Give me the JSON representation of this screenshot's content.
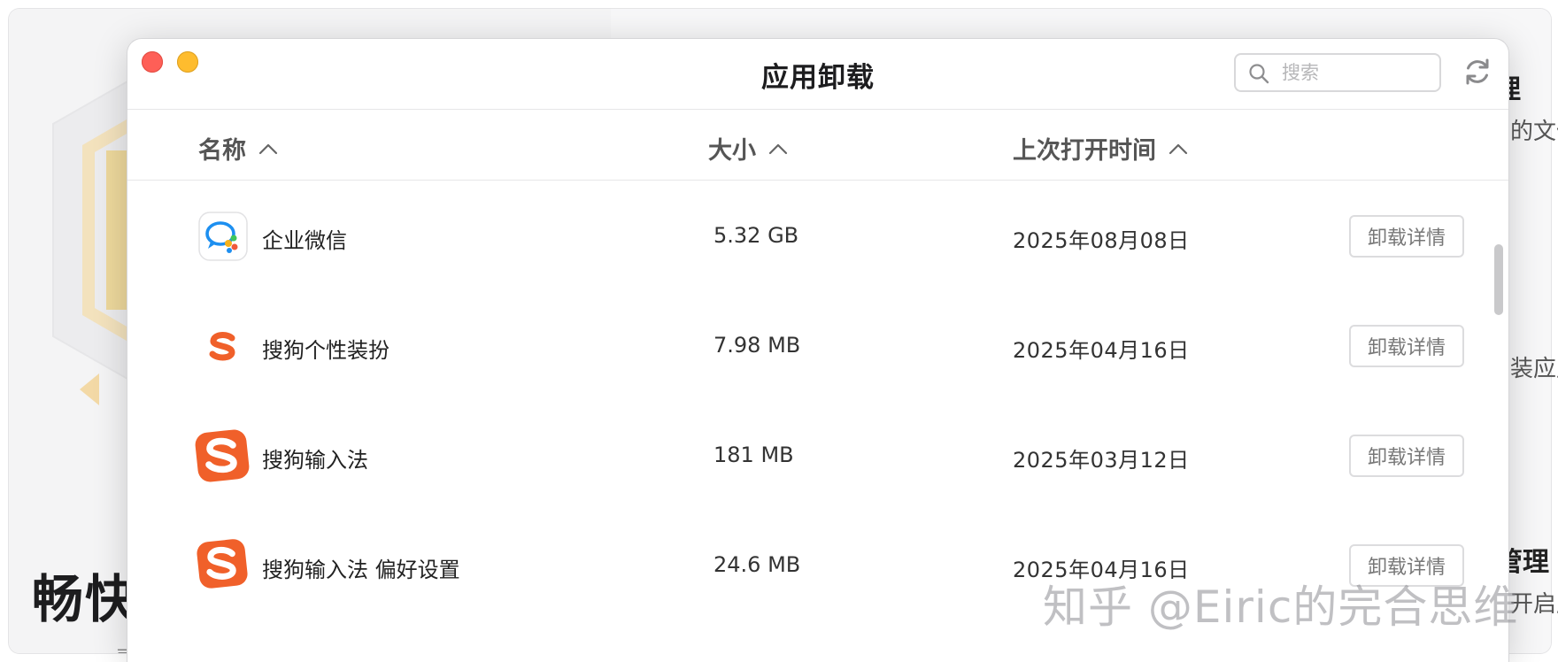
{
  "background": {
    "headline": "畅快",
    "sub_left": "录",
    "right_texts": [
      "理",
      "的文件",
      "装应用",
      "管理",
      "开启应"
    ]
  },
  "dialog": {
    "title": "应用卸载",
    "search": {
      "placeholder": "搜索",
      "value": ""
    },
    "columns": [
      {
        "label": "名称",
        "sort": "ascending"
      },
      {
        "label": "大小",
        "sort": "ascending"
      },
      {
        "label": "上次打开时间",
        "sort": "ascending"
      }
    ],
    "apps": [
      {
        "name": "企业微信",
        "size": "5.32 GB",
        "last_opened": "2025年08月08日",
        "action": "卸载详情",
        "icon": "wecom-icon"
      },
      {
        "name": "搜狗个性装扮",
        "size": "7.98 MB",
        "last_opened": "2025年04月16日",
        "action": "卸载详情",
        "icon": "sogou-skin-icon"
      },
      {
        "name": "搜狗输入法",
        "size": "181 MB",
        "last_opened": "2025年03月12日",
        "action": "卸载详情",
        "icon": "sogou-ime-icon"
      },
      {
        "name": "搜狗输入法 偏好设置",
        "size": "24.6 MB",
        "last_opened": "2025年04月16日",
        "action": "卸载详情",
        "icon": "sogou-prefs-icon"
      }
    ]
  },
  "watermark": "知乎 @Eiric的完合思维",
  "colors": {
    "close": "#fe5f57",
    "minimize": "#febc2e",
    "sogou_orange": "#f0602a",
    "wecom_blue": "#1d8ff0",
    "scrollbar": "#c9c9cb"
  }
}
